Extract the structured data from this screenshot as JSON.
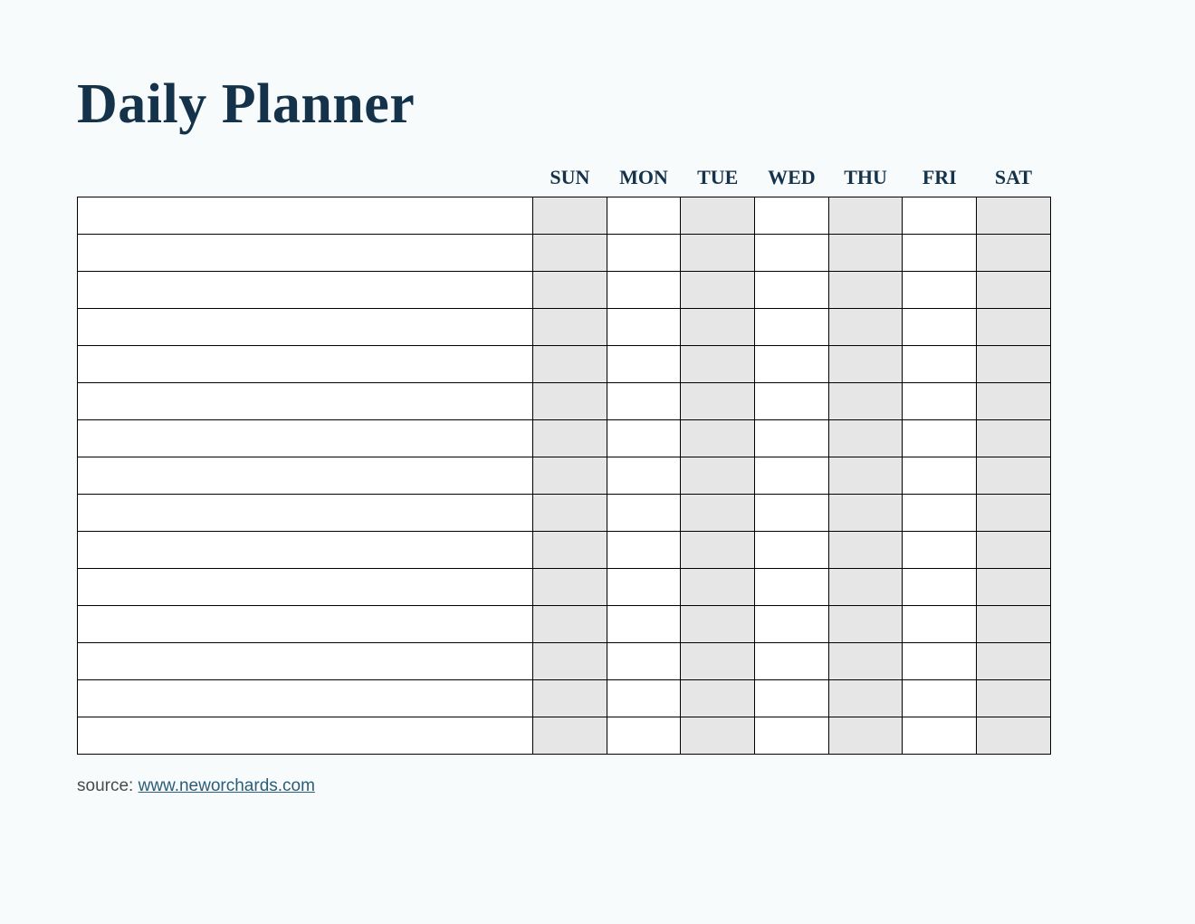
{
  "title": "Daily Planner",
  "days": [
    "SUN",
    "MON",
    "TUE",
    "WED",
    "THU",
    "FRI",
    "SAT"
  ],
  "shaded_day_indices": [
    0,
    2,
    4,
    6
  ],
  "row_count": 15,
  "footer": {
    "label": "source: ",
    "link_text": "www.neworchards.com"
  },
  "colors": {
    "page_bg": "#f8fbfb",
    "text": "#14324a",
    "cell_border": "#000000",
    "shaded_cell": "#e6e6e6",
    "link": "#2a5d7a"
  }
}
